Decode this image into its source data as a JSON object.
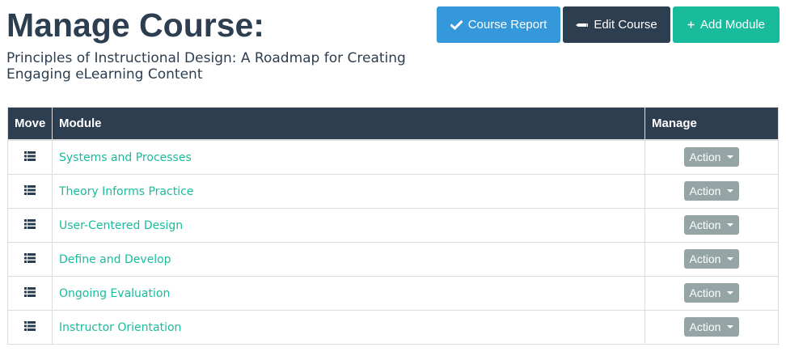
{
  "header": {
    "title": "Manage Course:",
    "course_name": "Principles of Instructional Design: A Roadmap for Creating Engaging eLearning Content"
  },
  "toolbar": {
    "report_label": "Course Report",
    "edit_label": "Edit Course",
    "add_label": "Add Module",
    "report_icon": "check-icon",
    "edit_icon": "pencil-icon",
    "add_icon": "plus-icon"
  },
  "table": {
    "columns": [
      "Move",
      "Module",
      "Manage"
    ],
    "rows": [
      {
        "module": "Systems and Processes",
        "action": "Action"
      },
      {
        "module": "Theory Informs Practice",
        "action": "Action"
      },
      {
        "module": "User-Centered Design",
        "action": "Action"
      },
      {
        "module": "Define and Develop",
        "action": "Action"
      },
      {
        "module": "Ongoing Evaluation",
        "action": "Action"
      },
      {
        "module": "Instructor Orientation",
        "action": "Action"
      }
    ]
  },
  "colors": {
    "primary_dark": "#2c3e50",
    "info": "#3498db",
    "success": "#18bc9c",
    "muted": "#95a5a6",
    "border": "#dddddd"
  }
}
